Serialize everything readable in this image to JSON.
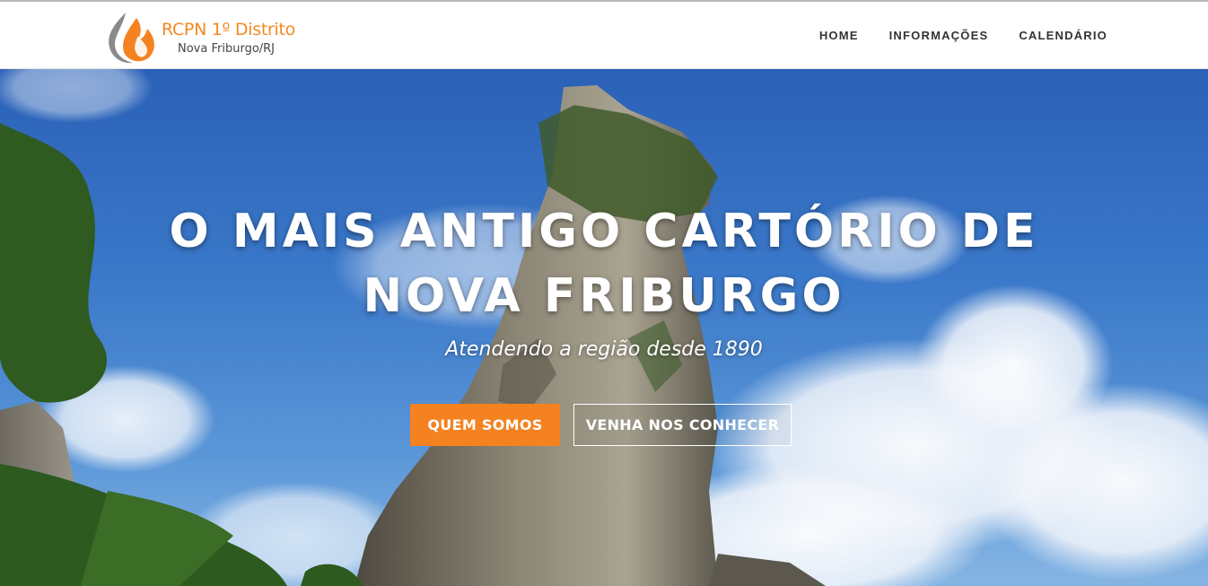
{
  "header": {
    "brand_title": "RCPN 1º Distrito",
    "brand_subtitle": "Nova Friburgo/RJ",
    "logo_icon": "flame-logo-icon",
    "nav": [
      {
        "label": "HOME"
      },
      {
        "label": "INFORMAÇÕES"
      },
      {
        "label": "CALENDÁRIO"
      }
    ]
  },
  "hero": {
    "title": "O MAIS ANTIGO CARTÓRIO DE NOVA FRIBURGO",
    "subtitle": "Atendendo a região desde 1890",
    "primary_button": "QUEM SOMOS",
    "secondary_button": "VENHA NOS CONHECER"
  },
  "colors": {
    "accent": "#f58220",
    "brand_orange": "#f08a22",
    "nav_text": "#333333",
    "sky": "#2b61b7"
  }
}
